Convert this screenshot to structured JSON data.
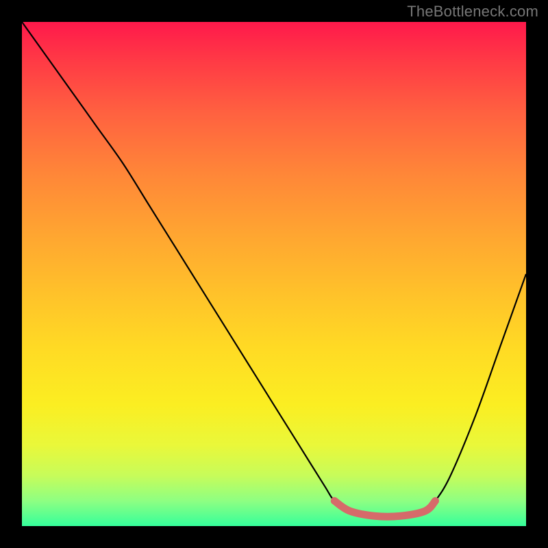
{
  "watermark": "TheBottleneck.com",
  "chart_data": {
    "type": "line",
    "title": "",
    "xlabel": "",
    "ylabel": "",
    "xlim": [
      0,
      100
    ],
    "ylim": [
      0,
      100
    ],
    "grid": false,
    "series": [
      {
        "name": "curve",
        "x": [
          0,
          5,
          10,
          15,
          20,
          25,
          30,
          35,
          40,
          45,
          50,
          55,
          60,
          62,
          65,
          70,
          75,
          80,
          82,
          85,
          90,
          95,
          100
        ],
        "y": [
          100,
          93,
          86,
          79,
          72,
          64,
          56,
          48,
          40,
          32,
          24,
          16,
          8,
          5,
          3,
          2,
          2,
          3,
          5,
          10,
          22,
          36,
          50
        ]
      }
    ],
    "highlight_range": {
      "x_start": 62,
      "x_end": 82
    },
    "background_gradient": {
      "direction": "top-to-bottom",
      "stops": [
        {
          "pos": 0.0,
          "color": "#ff194b"
        },
        {
          "pos": 0.5,
          "color": "#ffc22a"
        },
        {
          "pos": 0.8,
          "color": "#f3f52d"
        },
        {
          "pos": 1.0,
          "color": "#35ff9b"
        }
      ]
    }
  }
}
